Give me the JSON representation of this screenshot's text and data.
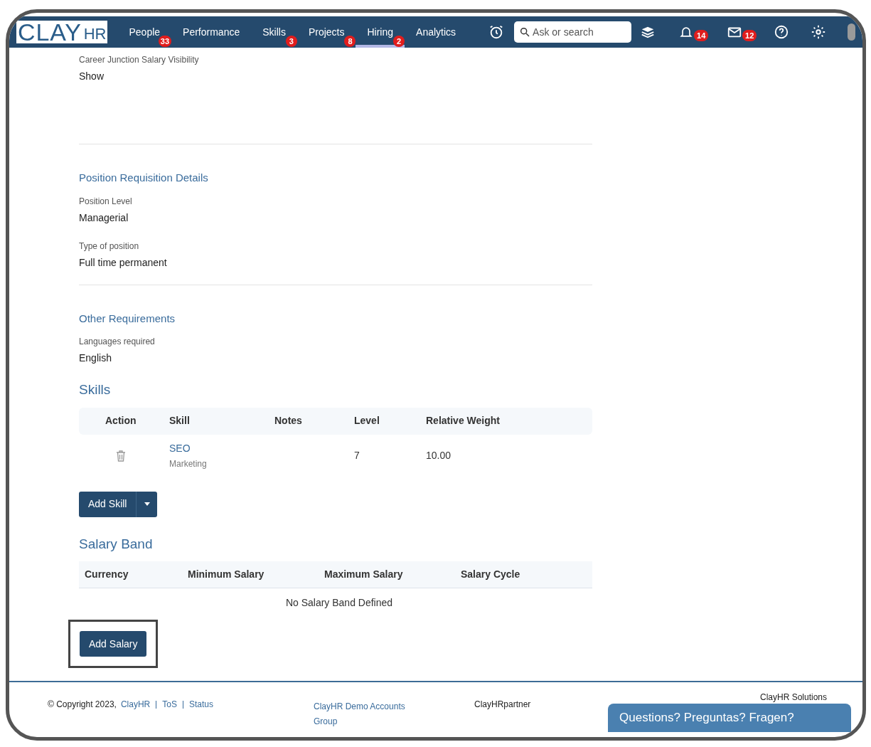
{
  "nav": {
    "logo": {
      "main": "CLAY",
      "sub": "HR"
    },
    "items": [
      {
        "label": "People",
        "badge": "33",
        "selected": false
      },
      {
        "label": "Performance",
        "selected": false
      },
      {
        "label": "Skills",
        "badge": "3",
        "selected": false
      },
      {
        "label": "Projects",
        "badge": "8",
        "selected": false
      },
      {
        "label": "Hiring",
        "badge": "2",
        "selected": true
      },
      {
        "label": "Analytics",
        "selected": false
      }
    ],
    "search": {
      "placeholder": "Ask or search"
    },
    "notifications_badge": "14",
    "messages_badge": "12"
  },
  "top_field": {
    "label": "Career Junction Salary Visibility",
    "value": "Show"
  },
  "sections": [
    {
      "title": "Position Requisition Details",
      "fields": [
        {
          "label": "Position Level",
          "value": "Managerial"
        },
        {
          "label": "Type of position",
          "value": "Full time permanent"
        }
      ]
    },
    {
      "title": "Other Requirements",
      "fields": [
        {
          "label": "Languages required",
          "value": "English"
        }
      ]
    }
  ],
  "skills": {
    "title": "Skills",
    "columns": [
      "Action",
      "Skill",
      "Notes",
      "Level",
      "Relative Weight"
    ],
    "rows": [
      {
        "skill": "SEO",
        "category": "Marketing",
        "notes": "",
        "level": "7",
        "weight": "10.00"
      }
    ],
    "add_button": "Add Skill"
  },
  "salary": {
    "title": "Salary Band",
    "columns": [
      "Currency",
      "Minimum Salary",
      "Maximum Salary",
      "Salary Cycle"
    ],
    "empty": "No Salary Band Defined",
    "add_button": "Add Salary",
    "highlighted": true
  },
  "footer": {
    "copyright": "© Copyright 2023, ",
    "links": [
      "ClayHR",
      "ToS",
      "Status"
    ],
    "demo_link": "ClayHR Demo Accounts Group",
    "partner": "ClayHRpartner",
    "solutions": "ClayHR Solutions"
  },
  "chat": {
    "label": "Questions? Preguntas? Fragen?"
  }
}
